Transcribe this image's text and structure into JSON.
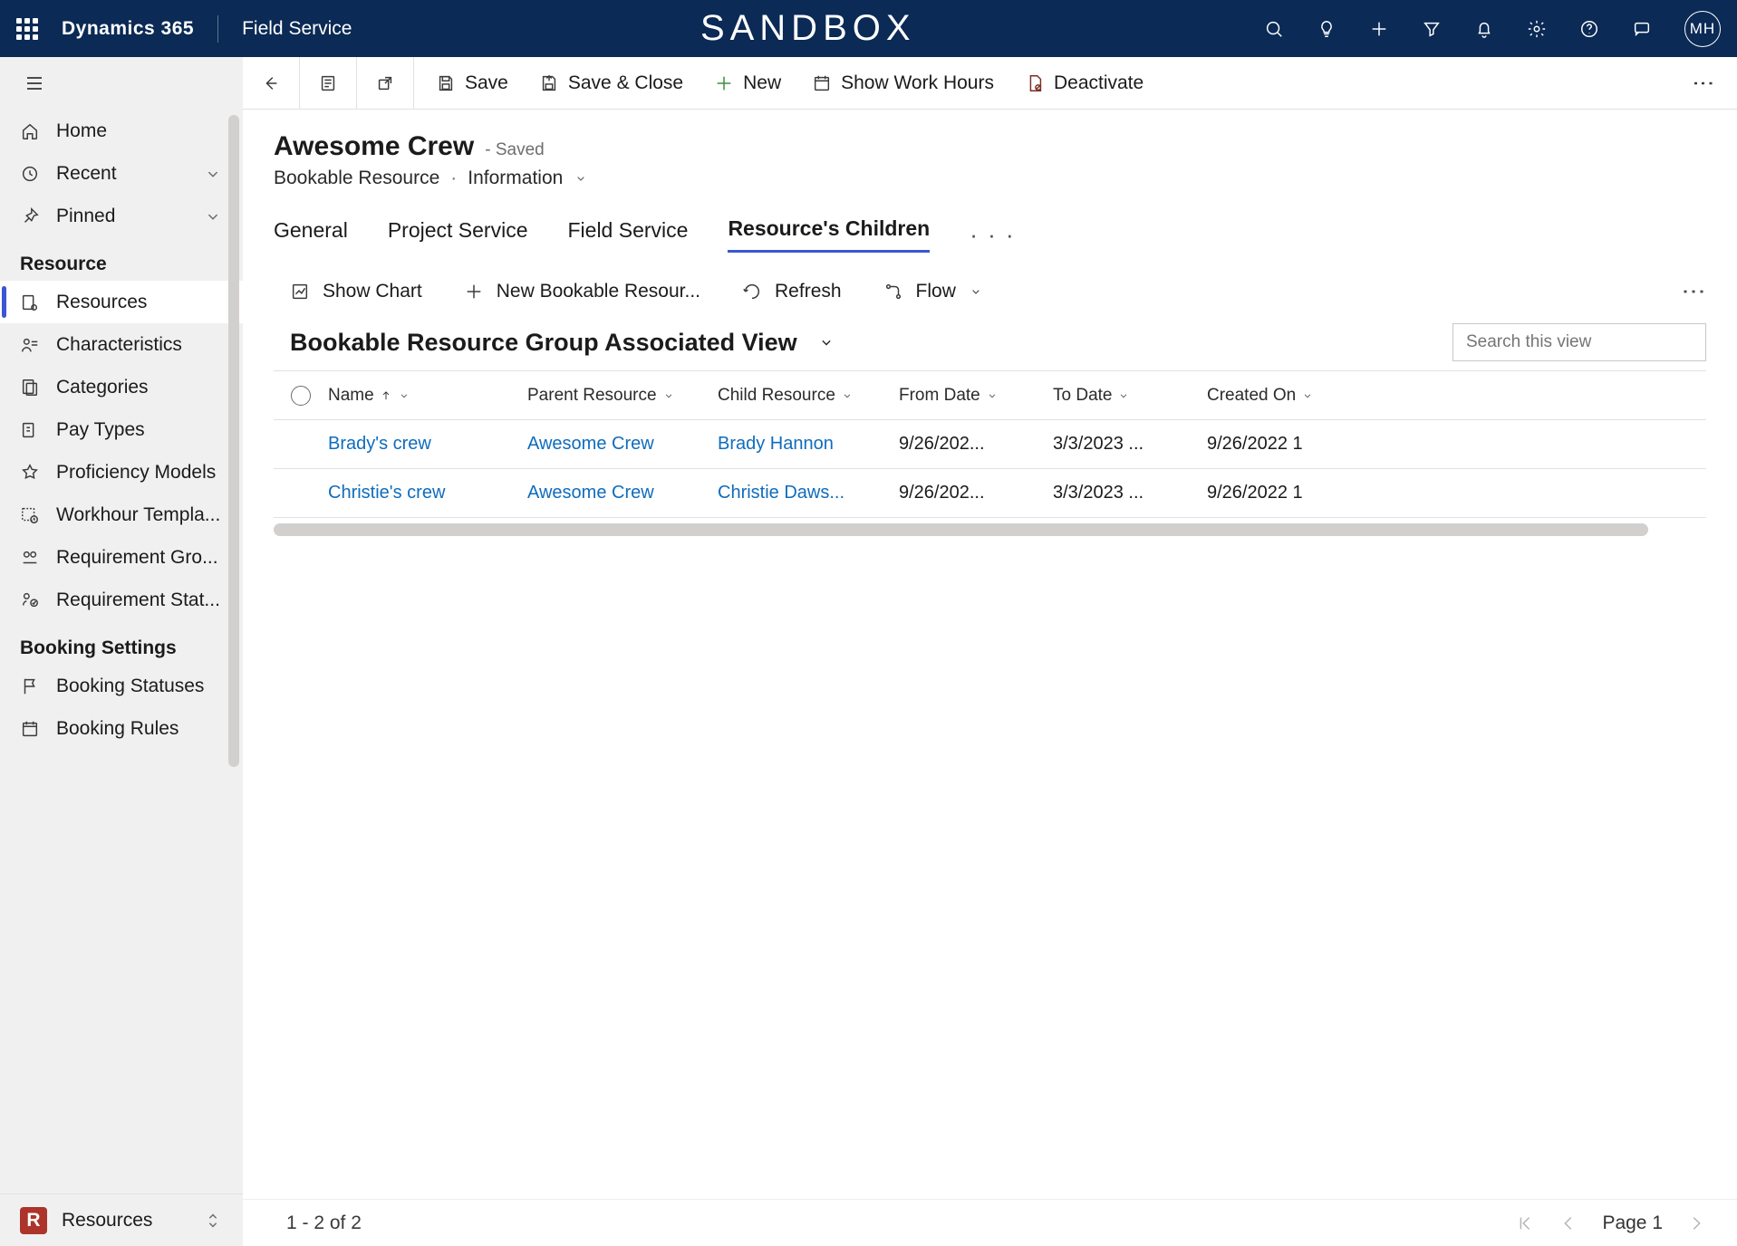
{
  "topbar": {
    "brand": "Dynamics 365",
    "app": "Field Service",
    "env": "SANDBOX",
    "avatar": "MH"
  },
  "sidebar": {
    "home": "Home",
    "recent": "Recent",
    "pinned": "Pinned",
    "section_resource": "Resource",
    "items_resource": [
      "Resources",
      "Characteristics",
      "Categories",
      "Pay Types",
      "Proficiency Models",
      "Workhour Templa...",
      "Requirement Gro...",
      "Requirement Stat..."
    ],
    "section_booking": "Booking Settings",
    "items_booking": [
      "Booking Statuses",
      "Booking Rules"
    ],
    "area_badge": "R",
    "area_label": "Resources"
  },
  "cmdbar": {
    "save": "Save",
    "save_close": "Save & Close",
    "new": "New",
    "work_hours": "Show Work Hours",
    "deactivate": "Deactivate"
  },
  "record": {
    "title": "Awesome Crew",
    "saved": "- Saved",
    "entity": "Bookable Resource",
    "form": "Information"
  },
  "tabs": [
    "General",
    "Project Service",
    "Field Service",
    "Resource's Children"
  ],
  "tab_active_index": 3,
  "subcmd": {
    "show_chart": "Show Chart",
    "new_child": "New Bookable Resour...",
    "refresh": "Refresh",
    "flow": "Flow"
  },
  "view_name": "Bookable Resource Group Associated View",
  "search_placeholder": "Search this view",
  "columns": [
    "Name",
    "Parent Resource",
    "Child Resource",
    "From Date",
    "To Date",
    "Created On"
  ],
  "rows": [
    {
      "name": "Brady's crew",
      "parent": "Awesome Crew",
      "child": "Brady Hannon",
      "from": "9/26/202...",
      "to": "3/3/2023 ...",
      "created": "9/26/2022 1"
    },
    {
      "name": "Christie's crew",
      "parent": "Awesome Crew",
      "child": "Christie Daws...",
      "from": "9/26/202...",
      "to": "3/3/2023 ...",
      "created": "9/26/2022 1"
    }
  ],
  "footer": {
    "range": "1 - 2 of 2",
    "page": "Page 1"
  }
}
